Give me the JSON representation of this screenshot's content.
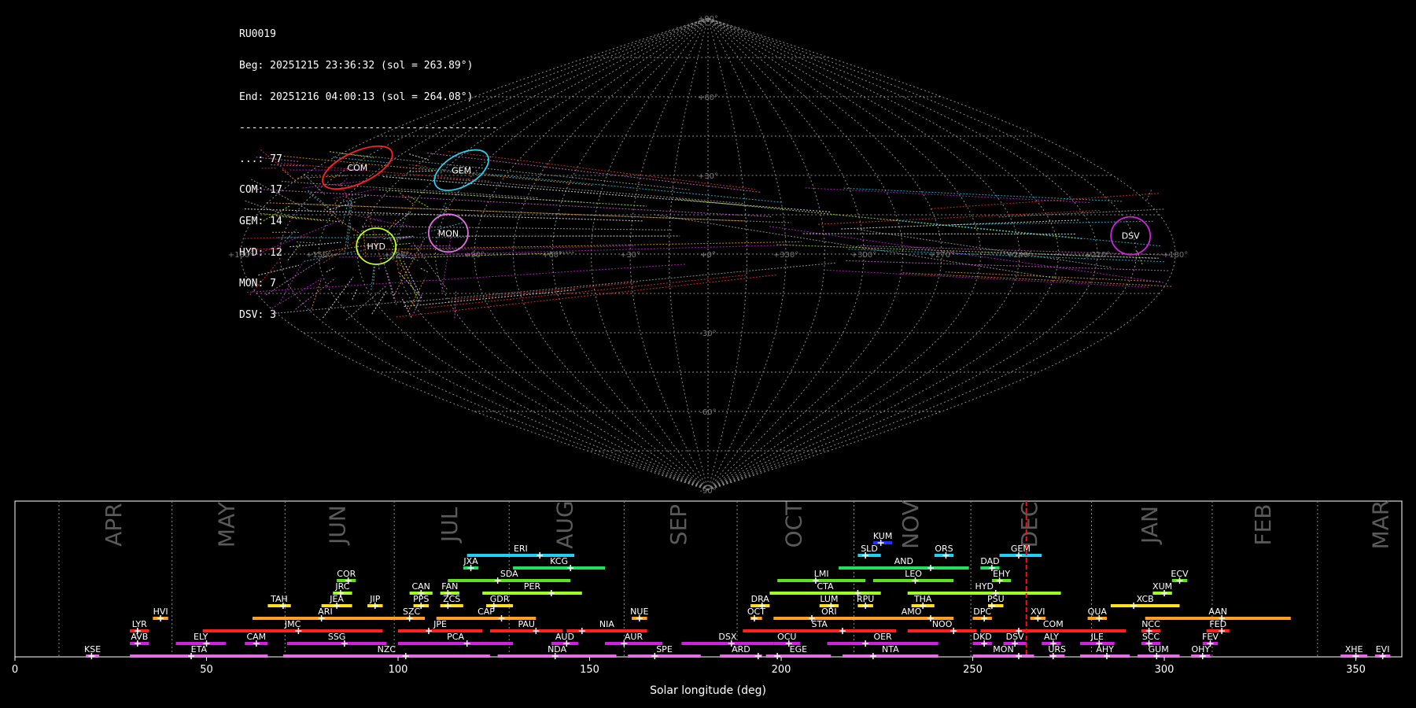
{
  "header": {
    "station": "RU0019",
    "begin": "Beg: 20251215 23:36:32 (sol = 263.89°)",
    "end": "End: 20251216 04:00:13 (sol = 264.08°)",
    "separator": "------------------------------------------",
    "counts": [
      "...: 77",
      "COM: 17",
      "GEM: 14",
      "HYD: 12",
      "MON: 7",
      "DSV: 3"
    ]
  },
  "sky_map": {
    "projection": "sinusoidal",
    "lat_labels": [
      "+90°",
      "+60°",
      "+30°",
      "+0°",
      "-30°",
      "-60°",
      "-90°"
    ],
    "lon_labels": [
      "+180°",
      "+150°",
      "+120°",
      "+90°",
      "+60°",
      "+30°",
      "+0°",
      "+330°",
      "+300°",
      "+270°",
      "+240°",
      "+210°",
      "+180°"
    ],
    "radiants": [
      {
        "code": "COM",
        "lon": 161,
        "lat": 33,
        "color": "#ff2020"
      },
      {
        "code": "GEM",
        "lon": 112,
        "lat": 32,
        "color": "#20d0f0"
      },
      {
        "code": "MON",
        "lon": 101,
        "lat": 8,
        "color": "#e070e0"
      },
      {
        "code": "HYD",
        "lon": 128,
        "lat": 3,
        "color": "#c0ff20"
      },
      {
        "code": "DSV",
        "lon": 196,
        "lat": 7,
        "color": "#d020e0"
      }
    ]
  },
  "chart_data": {
    "type": "bar",
    "xlabel": "Solar longitude (deg)",
    "xlim": [
      0,
      362
    ],
    "xticks": [
      0,
      50,
      100,
      150,
      200,
      250,
      300,
      350
    ],
    "months": [
      {
        "label": "APR",
        "boundary": 11.5
      },
      {
        "label": "MAY",
        "boundary": 41
      },
      {
        "label": "JUN",
        "boundary": 70.5
      },
      {
        "label": "JUL",
        "boundary": 99
      },
      {
        "label": "AUG",
        "boundary": 129
      },
      {
        "label": "SEP",
        "boundary": 159
      },
      {
        "label": "OCT",
        "boundary": 188.5
      },
      {
        "label": "NOV",
        "boundary": 219
      },
      {
        "label": "DEC",
        "boundary": 249.5
      },
      {
        "label": "JAN",
        "boundary": 281
      },
      {
        "label": "FEB",
        "boundary": 312.5
      },
      {
        "label": "MAR",
        "boundary": 340
      }
    ],
    "current_sol": 264,
    "showers": [
      {
        "code": "KSE",
        "start": 18.5,
        "end": 22,
        "peak": 20,
        "row": 0,
        "color": "#e070e0"
      },
      {
        "code": "ETA",
        "start": 30,
        "end": 66,
        "peak": 46,
        "row": 0,
        "color": "#e070e0"
      },
      {
        "code": "NZC",
        "start": 70,
        "end": 124,
        "peak": 102,
        "row": 0,
        "color": "#e070e0"
      },
      {
        "code": "NDA",
        "start": 126,
        "end": 157,
        "peak": 141,
        "row": 0,
        "color": "#e070e0"
      },
      {
        "code": "SPE",
        "start": 160,
        "end": 179,
        "peak": 167,
        "row": 0,
        "color": "#e070e0"
      },
      {
        "code": "ARD",
        "start": 184,
        "end": 195,
        "peak": 194,
        "row": 0,
        "color": "#e070e0"
      },
      {
        "code": "EGE",
        "start": 196,
        "end": 213,
        "peak": 199,
        "row": 0,
        "color": "#e070e0"
      },
      {
        "code": "NTA",
        "start": 216,
        "end": 241,
        "peak": 224,
        "row": 0,
        "color": "#e070e0"
      },
      {
        "code": "MON",
        "start": 250,
        "end": 266,
        "peak": 262,
        "row": 0,
        "color": "#e070e0"
      },
      {
        "code": "URS",
        "start": 270,
        "end": 274,
        "peak": 271,
        "row": 0,
        "color": "#e070e0"
      },
      {
        "code": "AHY",
        "start": 278,
        "end": 291,
        "peak": 285,
        "row": 0,
        "color": "#e070e0"
      },
      {
        "code": "GUM",
        "start": 293,
        "end": 304,
        "peak": 298,
        "row": 0,
        "color": "#e070e0"
      },
      {
        "code": "OHY",
        "start": 307,
        "end": 312,
        "peak": 310,
        "row": 0,
        "color": "#e070e0"
      },
      {
        "code": "XHE",
        "start": 346,
        "end": 353,
        "peak": 350,
        "row": 0,
        "color": "#e070e0"
      },
      {
        "code": "EVI",
        "start": 355,
        "end": 359,
        "peak": 357,
        "row": 0,
        "color": "#e070e0"
      },
      {
        "code": "AVB",
        "start": 30,
        "end": 35,
        "peak": 32,
        "row": 1,
        "color": "#d020e0"
      },
      {
        "code": "ELY",
        "start": 42,
        "end": 55,
        "peak": 50,
        "row": 1,
        "color": "#d020e0"
      },
      {
        "code": "CAM",
        "start": 60,
        "end": 66,
        "peak": 63,
        "row": 1,
        "color": "#d020e0"
      },
      {
        "code": "SSG",
        "start": 71,
        "end": 97,
        "peak": 86,
        "row": 1,
        "color": "#d020e0"
      },
      {
        "code": "PCA",
        "start": 100,
        "end": 130,
        "peak": 118,
        "row": 1,
        "color": "#d020e0"
      },
      {
        "code": "AUD",
        "start": 140,
        "end": 147,
        "peak": 144,
        "row": 1,
        "color": "#d020e0"
      },
      {
        "code": "AUR",
        "start": 154,
        "end": 169,
        "peak": 159,
        "row": 1,
        "color": "#d020e0"
      },
      {
        "code": "DSX",
        "start": 174,
        "end": 198,
        "peak": 187,
        "row": 1,
        "color": "#d020e0"
      },
      {
        "code": "OCU",
        "start": 198,
        "end": 205,
        "peak": 202,
        "row": 1,
        "color": "#d020e0"
      },
      {
        "code": "OER",
        "start": 212,
        "end": 241,
        "peak": 222,
        "row": 1,
        "color": "#d020e0"
      },
      {
        "code": "DKD",
        "start": 250,
        "end": 255,
        "peak": 253,
        "row": 1,
        "color": "#d020e0"
      },
      {
        "code": "DSV",
        "start": 258,
        "end": 264,
        "peak": 261,
        "row": 1,
        "color": "#d020e0"
      },
      {
        "code": "ALY",
        "start": 268,
        "end": 273,
        "peak": 271,
        "row": 1,
        "color": "#d020e0"
      },
      {
        "code": "JLE",
        "start": 278,
        "end": 287,
        "peak": 283,
        "row": 1,
        "color": "#d020e0"
      },
      {
        "code": "SCC",
        "start": 294,
        "end": 299,
        "peak": 296,
        "row": 1,
        "color": "#d020e0"
      },
      {
        "code": "FEV",
        "start": 310,
        "end": 314,
        "peak": 312,
        "row": 1,
        "color": "#d020e0"
      },
      {
        "code": "LYR",
        "start": 30,
        "end": 35,
        "peak": 32,
        "row": 2,
        "color": "#ff2020"
      },
      {
        "code": "JMC",
        "start": 49,
        "end": 96,
        "peak": 74,
        "row": 2,
        "color": "#ff2020"
      },
      {
        "code": "JPE",
        "start": 100,
        "end": 122,
        "peak": 108,
        "row": 2,
        "color": "#ff2020"
      },
      {
        "code": "PAU",
        "start": 124,
        "end": 143,
        "peak": 136,
        "row": 2,
        "color": "#ff2020"
      },
      {
        "code": "NIA",
        "start": 144,
        "end": 165,
        "peak": 148,
        "row": 2,
        "color": "#ff2020"
      },
      {
        "code": "STA",
        "start": 190,
        "end": 230,
        "peak": 216,
        "row": 2,
        "color": "#ff2020"
      },
      {
        "code": "NOO",
        "start": 233,
        "end": 251,
        "peak": 245,
        "row": 2,
        "color": "#ff2020"
      },
      {
        "code": "COM",
        "start": 252,
        "end": 290,
        "peak": 262,
        "row": 2,
        "color": "#ff2020"
      },
      {
        "code": "NCC",
        "start": 294,
        "end": 299,
        "peak": 296,
        "row": 2,
        "color": "#ff2020"
      },
      {
        "code": "FED",
        "start": 311,
        "end": 317,
        "peak": 315,
        "row": 2,
        "color": "#ff2020"
      },
      {
        "code": "HVI",
        "start": 36,
        "end": 40,
        "peak": 38,
        "row": 3,
        "color": "#ffa020"
      },
      {
        "code": "ARI",
        "start": 62,
        "end": 100,
        "peak": 80,
        "row": 3,
        "color": "#ffa020"
      },
      {
        "code": "SZC",
        "start": 100,
        "end": 107,
        "peak": 103,
        "row": 3,
        "color": "#ffa020"
      },
      {
        "code": "CAP",
        "start": 110,
        "end": 136,
        "peak": 127,
        "row": 3,
        "color": "#ffa020"
      },
      {
        "code": "NUE",
        "start": 161,
        "end": 165,
        "peak": 163,
        "row": 3,
        "color": "#ffa020"
      },
      {
        "code": "OCT",
        "start": 192,
        "end": 195,
        "peak": 193,
        "row": 3,
        "color": "#ffa020"
      },
      {
        "code": "ORI",
        "start": 198,
        "end": 227,
        "peak": 208,
        "row": 3,
        "color": "#ffa020"
      },
      {
        "code": "AMO",
        "start": 223,
        "end": 245,
        "peak": 239,
        "row": 3,
        "color": "#ffa020"
      },
      {
        "code": "DPC",
        "start": 250,
        "end": 255,
        "peak": 253,
        "row": 3,
        "color": "#ffa020"
      },
      {
        "code": "XVI",
        "start": 265,
        "end": 269,
        "peak": 267,
        "row": 3,
        "color": "#ffa020"
      },
      {
        "code": "QUA",
        "start": 280,
        "end": 285,
        "peak": 283,
        "row": 3,
        "color": "#ffa020"
      },
      {
        "code": "AAN",
        "start": 295,
        "end": 333,
        "peak": 315,
        "row": 3,
        "color": "#ffa020"
      },
      {
        "code": "TAH",
        "start": 66,
        "end": 72,
        "peak": 70,
        "row": 4,
        "color": "#ffe020"
      },
      {
        "code": "JEA",
        "start": 80,
        "end": 88,
        "peak": 84,
        "row": 4,
        "color": "#ffe020"
      },
      {
        "code": "JIP",
        "start": 92,
        "end": 96,
        "peak": 94,
        "row": 4,
        "color": "#ffe020"
      },
      {
        "code": "PPS",
        "start": 104,
        "end": 108,
        "peak": 106,
        "row": 4,
        "color": "#ffe020"
      },
      {
        "code": "ZCS",
        "start": 111,
        "end": 117,
        "peak": 113,
        "row": 4,
        "color": "#ffe020"
      },
      {
        "code": "GDR",
        "start": 123,
        "end": 130,
        "peak": 125,
        "row": 4,
        "color": "#ffe020"
      },
      {
        "code": "DRA",
        "start": 192,
        "end": 197,
        "peak": 195,
        "row": 4,
        "color": "#ffe020"
      },
      {
        "code": "LUM",
        "start": 210,
        "end": 215,
        "peak": 213,
        "row": 4,
        "color": "#ffe020"
      },
      {
        "code": "RPU",
        "start": 220,
        "end": 224,
        "peak": 222,
        "row": 4,
        "color": "#ffe020"
      },
      {
        "code": "THA",
        "start": 234,
        "end": 240,
        "peak": 237,
        "row": 4,
        "color": "#ffe020"
      },
      {
        "code": "PSU",
        "start": 254,
        "end": 258,
        "peak": 255,
        "row": 4,
        "color": "#ffe020"
      },
      {
        "code": "XCB",
        "start": 286,
        "end": 304,
        "peak": 292,
        "row": 4,
        "color": "#ffe020"
      },
      {
        "code": "JRC",
        "start": 83,
        "end": 88,
        "peak": 85,
        "row": 5,
        "color": "#a0ff20"
      },
      {
        "code": "CAN",
        "start": 103,
        "end": 109,
        "peak": 106,
        "row": 5,
        "color": "#a0ff20"
      },
      {
        "code": "FAN",
        "start": 111,
        "end": 116,
        "peak": 113,
        "row": 5,
        "color": "#a0ff20"
      },
      {
        "code": "PER",
        "start": 122,
        "end": 148,
        "peak": 140,
        "row": 5,
        "color": "#a0ff20"
      },
      {
        "code": "CTA",
        "start": 197,
        "end": 226,
        "peak": 220,
        "row": 5,
        "color": "#a0ff20"
      },
      {
        "code": "HYD",
        "start": 233,
        "end": 273,
        "peak": 256,
        "row": 5,
        "color": "#a0ff20"
      },
      {
        "code": "XUM",
        "start": 297,
        "end": 302,
        "peak": 300,
        "row": 5,
        "color": "#a0ff20"
      },
      {
        "code": "COR",
        "start": 84,
        "end": 89,
        "peak": 87,
        "row": 6,
        "color": "#60e020"
      },
      {
        "code": "SDA",
        "start": 113,
        "end": 145,
        "peak": 126,
        "row": 6,
        "color": "#60e020"
      },
      {
        "code": "LMI",
        "start": 199,
        "end": 222,
        "peak": 209,
        "row": 6,
        "color": "#60e020"
      },
      {
        "code": "LEO",
        "start": 224,
        "end": 245,
        "peak": 235,
        "row": 6,
        "color": "#60e020"
      },
      {
        "code": "EHY",
        "start": 255,
        "end": 260,
        "peak": 257,
        "row": 6,
        "color": "#60e020"
      },
      {
        "code": "ECV",
        "start": 302,
        "end": 306,
        "peak": 304,
        "row": 6,
        "color": "#60e020"
      },
      {
        "code": "JXA",
        "start": 117,
        "end": 121,
        "peak": 119,
        "row": 7,
        "color": "#20e060"
      },
      {
        "code": "KCG",
        "start": 130,
        "end": 154,
        "peak": 145,
        "row": 7,
        "color": "#20e060"
      },
      {
        "code": "AND",
        "start": 215,
        "end": 249,
        "peak": 239,
        "row": 7,
        "color": "#20e060"
      },
      {
        "code": "DAD",
        "start": 252,
        "end": 257,
        "peak": 255,
        "row": 7,
        "color": "#20e060"
      },
      {
        "code": "ERI",
        "start": 118,
        "end": 146,
        "peak": 137,
        "row": 8,
        "color": "#20d0f0"
      },
      {
        "code": "SLD",
        "start": 220,
        "end": 226,
        "peak": 222,
        "row": 8,
        "color": "#20d0f0"
      },
      {
        "code": "ORS",
        "start": 240,
        "end": 245,
        "peak": 243,
        "row": 8,
        "color": "#20d0f0"
      },
      {
        "code": "GEM",
        "start": 257,
        "end": 268,
        "peak": 262,
        "row": 8,
        "color": "#20d0f0"
      },
      {
        "code": "KUM",
        "start": 224,
        "end": 229,
        "peak": 226,
        "row": 9,
        "color": "#2030ff"
      }
    ]
  }
}
